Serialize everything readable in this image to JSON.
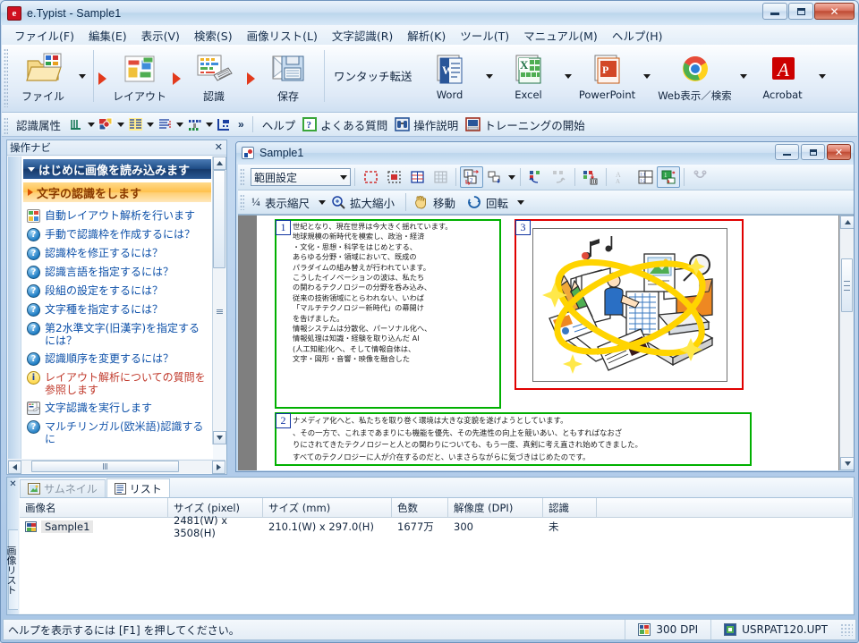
{
  "window": {
    "title": "e.Typist - Sample1",
    "app_icon": "e",
    "minimize": "minimize-icon",
    "maximize": "maximize-icon",
    "close": "✕"
  },
  "menubar": {
    "items": [
      {
        "label": "ファイル(F)",
        "accel": "F"
      },
      {
        "label": "編集(E)",
        "accel": "E"
      },
      {
        "label": "表示(V)",
        "accel": "V"
      },
      {
        "label": "検索(S)",
        "accel": "S"
      },
      {
        "label": "画像リスト(L)",
        "accel": "L"
      },
      {
        "label": "文字認識(R)",
        "accel": "R"
      },
      {
        "label": "解析(K)",
        "accel": "K"
      },
      {
        "label": "ツール(T)",
        "accel": "T"
      },
      {
        "label": "マニュアル(M)",
        "accel": "M"
      },
      {
        "label": "ヘルプ(H)",
        "accel": "H"
      }
    ]
  },
  "ribbon": {
    "file": "ファイル",
    "layout": "レイアウト",
    "recognize": "認識",
    "save": "保存",
    "one_touch_transfer": "ワンタッチ転送",
    "word": "Word",
    "excel": "Excel",
    "powerpoint": "PowerPoint",
    "web": "Web表示／検索",
    "acrobat": "Acrobat"
  },
  "toolbar2": {
    "recognition_attributes": "認識属性",
    "overflow": "»",
    "help": "ヘルプ",
    "faq": "よくある質問",
    "instructions": "操作説明",
    "training": "トレーニングの開始"
  },
  "navpanel": {
    "header": "操作ナビ",
    "close": "✕",
    "section_loaded": "はじめに画像を読み込みます",
    "section_recognize": "文字の認識をします",
    "links": [
      {
        "label": "自動レイアウト解析を行います",
        "icon": "layout-icon",
        "color": "blue"
      },
      {
        "label": "手動で認識枠を作成するには？",
        "icon": "question-icon",
        "color": "blue"
      },
      {
        "label": "認識枠を修正するには？",
        "icon": "question-icon",
        "color": "blue"
      },
      {
        "label": "認識言語を指定するには？",
        "icon": "question-icon",
        "color": "blue"
      },
      {
        "label": "段組の設定をするには？",
        "icon": "question-icon",
        "color": "blue"
      },
      {
        "label": "文字種を指定するには？",
        "icon": "question-icon",
        "color": "blue"
      },
      {
        "label": "第2水準文字(旧漢字)を指定するには？",
        "icon": "question-icon",
        "color": "blue"
      },
      {
        "label": "認識順序を変更するには？",
        "icon": "question-icon",
        "color": "blue"
      },
      {
        "label": "レイアウト解析についての質問を参照します",
        "icon": "info-icon",
        "color": "red"
      },
      {
        "label": "文字認識を実行します",
        "icon": "ocr-icon",
        "color": "blue"
      },
      {
        "label": "マルチリンガル(欧米語)認識するに",
        "icon": "question-icon",
        "color": "blue"
      }
    ]
  },
  "child_window": {
    "title": "Sample1",
    "minimize": "minimize-icon",
    "maximize": "maximize-icon",
    "close": "✕",
    "mode_combo": "範囲設定",
    "zoom_ratio_fraction": "¼",
    "zoom_ratio_label": "表示縮尺",
    "zoom_inout_label": "拡大縮小",
    "move_label": "移動",
    "rotate_label": "回転"
  },
  "document": {
    "blocks": [
      {
        "number": "1",
        "type": "text",
        "color": "#00b000",
        "text": "世紀となり、現在世界は今大きく揺れています。\n地球規模の新時代を模索し、政治・経済\n・文化・思想・科学をはじめとする、\nあらゆる分野・領域において、既成の\nパラダイムの組み替えが行われています。\nこうしたイノベーションの波は、私たち\nの関わるテクノロジーの分野を呑み込み、\n従来の技術領域にとらわれない、いわば\n「マルチテクノロジー新時代」の幕開け\nを告げました。\n情報システムは分散化、パーソナル化へ、\n情報処理は知識・経験を取り込んだ AI\n(人工知能)化へ、そして情報自体は、\n文字・図形・音響・映像を融合した"
      },
      {
        "number": "2",
        "type": "text",
        "color": "#00b000",
        "text": "ナメディア化へと、私たちを取り巻く環境は大きな変貌を遂げようとしています。\n、その一方で、これまであまりにも機能を優先、その先進性の向上を競いあい、ともすればなおざ\nりにされてきたテクノロジーと人との関わりについても、もう一度、真剣に考え直され始めてきました。\nすべてのテクノロジーに人が介在するのだと、いまさらながらに気づきはじめたのです。"
      },
      {
        "number": "3",
        "type": "image",
        "color": "#e00000",
        "description": "multimedia-illustration"
      }
    ]
  },
  "list_panel": {
    "close": "✕",
    "vertical_tab": "画像リスト",
    "tabs": [
      {
        "label": "サムネイル",
        "active": false,
        "icon": "thumbnail-icon"
      },
      {
        "label": "リスト",
        "active": true,
        "icon": "list-icon"
      }
    ],
    "columns": [
      "画像名",
      "サイズ (pixel)",
      "サイズ (mm)",
      "色数",
      "解像度 (DPI)",
      "認識",
      ""
    ],
    "rows": [
      {
        "name": "Sample1",
        "size_pixel": "2481(W) x 3508(H)",
        "size_mm": "210.1(W) x 297.0(H)",
        "colors": "1677万",
        "dpi": "300",
        "recognized": "未"
      }
    ]
  },
  "statusbar": {
    "message": "ヘルプを表示するには [F1] を押してください。",
    "dpi": "300 DPI",
    "pattern_file": "USRPAT120.UPT"
  },
  "colors": {
    "text_block_border": "#00b000",
    "image_block_border": "#e00000",
    "accent_blue": "#1f4e87",
    "accent_orange": "#ffc14d",
    "link_blue": "#0b4fa8",
    "link_red": "#c0392b"
  }
}
